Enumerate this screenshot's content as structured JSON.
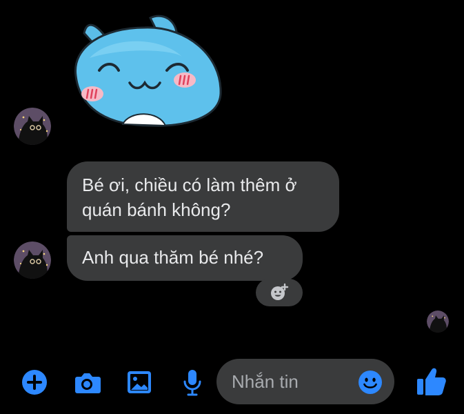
{
  "colors": {
    "background": "#000000",
    "bubble": "#3a3b3c",
    "accent": "#2d88ff",
    "bubble_text": "#e9eaec",
    "placeholder_text": "#a8abaf"
  },
  "conversation": {
    "sticker": {
      "icon": "blue-cat-sticker"
    },
    "messages": [
      {
        "text_line_1": "Bé ơi, chiều có làm thêm ở",
        "text_line_2": "quán bánh không?"
      },
      {
        "text": "Anh qua thăm bé nhé?"
      }
    ],
    "reaction_button": {
      "icon": "add-reaction-icon"
    }
  },
  "composer": {
    "buttons": [
      {
        "icon": "plus-icon"
      },
      {
        "icon": "camera-icon"
      },
      {
        "icon": "image-icon"
      },
      {
        "icon": "microphone-icon"
      }
    ],
    "input_placeholder": "Nhắn tin",
    "emoji_icon": "emoji-icon",
    "like_icon": "thumbs-up-icon"
  }
}
